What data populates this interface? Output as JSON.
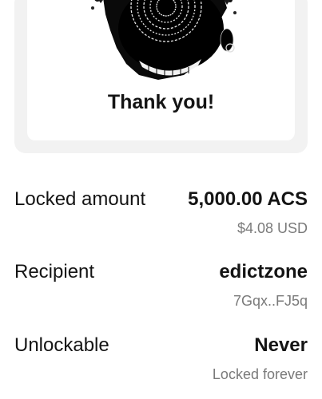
{
  "card": {
    "title": "Thank you!",
    "image_icon": "spiral-head-artwork-icon"
  },
  "details": [
    {
      "label": "Locked amount",
      "value": "5,000.00 ACS",
      "sub": "$4.08 USD"
    },
    {
      "label": "Recipient",
      "value": "edictzone",
      "sub": "7Gqx..FJ5q"
    },
    {
      "label": "Unlockable",
      "value": "Never",
      "sub": "Locked forever"
    }
  ]
}
